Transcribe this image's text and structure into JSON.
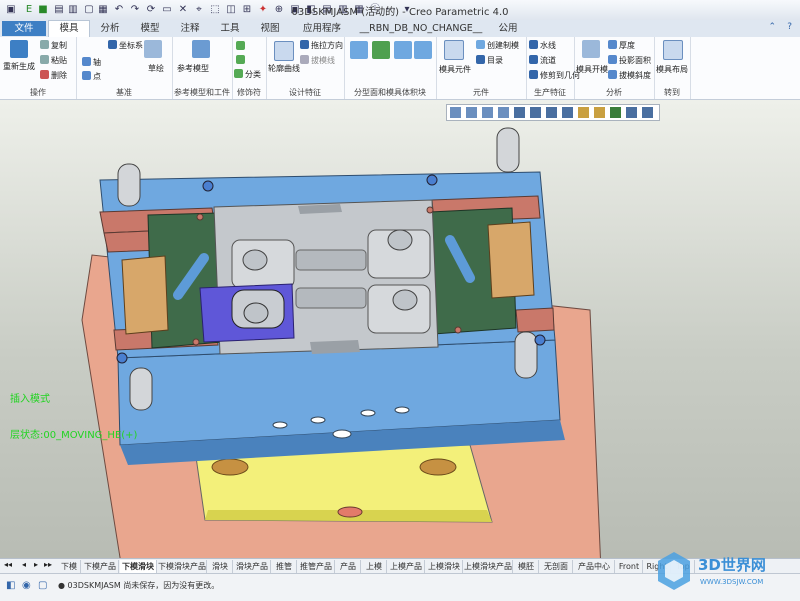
{
  "window": {
    "title": "03DSKMJASM (活动的) - Creo Parametric 4.0"
  },
  "tabs": [
    {
      "label": "文件",
      "kind": "file"
    },
    {
      "label": "模具",
      "kind": "active"
    },
    {
      "label": "分析"
    },
    {
      "label": "模型"
    },
    {
      "label": "注释"
    },
    {
      "label": "工具"
    },
    {
      "label": "视图"
    },
    {
      "label": "应用程序"
    },
    {
      "label": "__RBN_DB_NO_CHANGE__"
    },
    {
      "label": "公用"
    }
  ],
  "ribbon": {
    "groups": [
      {
        "label": "操作",
        "items": [
          "重新生成",
          "复制",
          "粘贴",
          "删除"
        ]
      },
      {
        "label": "基准",
        "items": [
          "坐标系",
          "轴",
          "点",
          "草绘"
        ]
      },
      {
        "label": "参考模型和工件",
        "items": [
          "参考模型"
        ]
      },
      {
        "label": "修饰符",
        "items": [
          "分类"
        ]
      },
      {
        "label": "设计特征",
        "items": [
          "轮廓曲线",
          "拖拉方向",
          "拔模线"
        ]
      },
      {
        "label": "分型面和模具体积块",
        "items": []
      },
      {
        "label": "元件",
        "items": [
          "模具元件",
          "创建制模",
          "目录"
        ]
      },
      {
        "label": "生产特征",
        "items": [
          "水线",
          "流道",
          "修剪到几何"
        ]
      },
      {
        "label": "分析",
        "items": [
          "模具开模",
          "厚度",
          "投影面积",
          "拔模斜度"
        ]
      },
      {
        "label": "转到",
        "items": [
          "模具布局"
        ]
      }
    ]
  },
  "viewport": {
    "overlay_mode": "插入模式",
    "overlay_state": "层状态:00_MOVING_HE(+)"
  },
  "bottom_tabs": [
    "下模",
    "下模产品",
    "下模滑块",
    "下模滑块产品",
    "滑块",
    "滑块产品",
    "推管",
    "推管产品",
    "产品",
    "上模",
    "上模产品",
    "上模滑块",
    "上模滑块产品",
    "模胚",
    "无剖面",
    "产品中心",
    "Front",
    "Right",
    "Top"
  ],
  "active_bottom_tab": "下模滑块",
  "status": {
    "message": "03DSKMJASM 尚未保存，因为没有更改。"
  },
  "watermark": {
    "main": "3D世界网",
    "url": "WWW.3DSJW.COM"
  },
  "colors": {
    "accent": "#3d7fc4",
    "overlay_text": "#22d422",
    "plate_blue": "#6fa8e0",
    "plate_salmon": "#e8a08a"
  }
}
